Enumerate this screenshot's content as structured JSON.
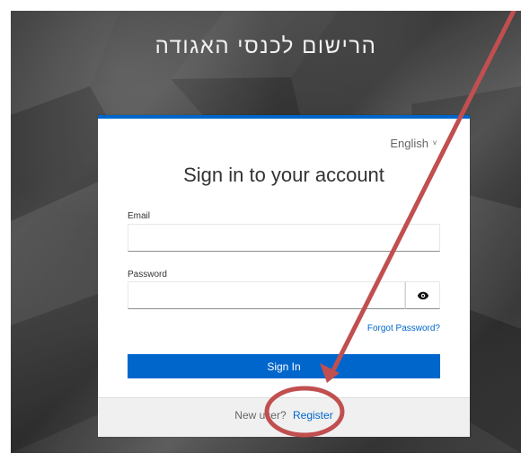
{
  "header": {
    "title": "הרישום לכנסי האגודה"
  },
  "card": {
    "language_label": "English",
    "heading": "Sign in to your account",
    "email_label": "Email",
    "email_value": "",
    "password_label": "Password",
    "password_value": "",
    "forgot_password": "Forgot Password?",
    "sign_in_label": "Sign In",
    "footer_prefix": "New user?",
    "register_label": "Register"
  },
  "colors": {
    "primary": "#0066cc",
    "annotation": "#c14f4f"
  },
  "icons": {
    "language_chevron": "chevron-down-icon",
    "password_toggle": "eye-icon"
  }
}
